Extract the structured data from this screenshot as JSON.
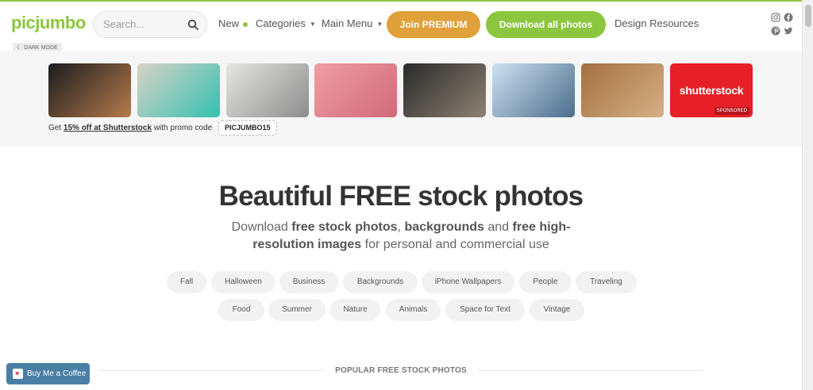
{
  "header": {
    "logo": "picjumbo",
    "search_placeholder": "Search...",
    "nav_new": "New",
    "nav_categories": "Categories",
    "nav_main_menu": "Main Menu",
    "btn_premium": "Join PREMIUM",
    "btn_download": "Download all photos",
    "nav_design": "Design Resources",
    "social_icons": [
      "instagram-icon",
      "facebook-icon",
      "pinterest-icon",
      "twitter-icon"
    ],
    "dark_mode": "DARK MODE"
  },
  "promo": {
    "thumbnails": [
      {
        "name": "gym-workout-photo",
        "colors": [
          "#1c1c1c",
          "#b77a4a"
        ]
      },
      {
        "name": "fitness-equipment-photo",
        "colors": [
          "#d9d2c6",
          "#33c1b1"
        ]
      },
      {
        "name": "lunge-exercise-photo",
        "colors": [
          "#e5e5e3",
          "#8d8d8d"
        ]
      },
      {
        "name": "yoga-mat-woman-photo",
        "colors": [
          "#ee9ea6",
          "#d26a79"
        ]
      },
      {
        "name": "group-fitness-class-photo",
        "colors": [
          "#2a2a2a",
          "#8d8273"
        ]
      },
      {
        "name": "seaside-stairs-run-photo",
        "colors": [
          "#cfe2f2",
          "#4b6d8c"
        ]
      },
      {
        "name": "sneakers-wood-photo",
        "colors": [
          "#a5703f",
          "#d5b086"
        ]
      }
    ],
    "sponsor_logo": "shutterstock",
    "sponsored_label": "SPONSORED",
    "text_prefix": "Get",
    "text_link": "15% off at Shutterstock",
    "text_suffix": "with promo code",
    "code": "PICJUMBO15"
  },
  "hero": {
    "title": "Beautiful FREE stock photos",
    "sub_1": "Download",
    "sub_2": "free stock photos",
    "sub_3": ",",
    "sub_4": "backgrounds",
    "sub_5": "and",
    "sub_6": "free high-resolution images",
    "sub_7": "for personal and commercial use"
  },
  "tags_row1": [
    "Fall",
    "Halloween",
    "Business",
    "Backgrounds",
    "iPhone Wallpapers",
    "People",
    "Traveling"
  ],
  "tags_row2": [
    "Food",
    "Summer",
    "Nature",
    "Animals",
    "Space for Text",
    "Vintage"
  ],
  "section_title": "POPULAR FREE STOCK PHOTOS",
  "coffee_label": "Buy Me a Coffee",
  "colors": {
    "accent": "#8cc63f",
    "premium": "#e0a03a",
    "sponsor": "#e71f26",
    "coffee": "#4a7fa5"
  }
}
